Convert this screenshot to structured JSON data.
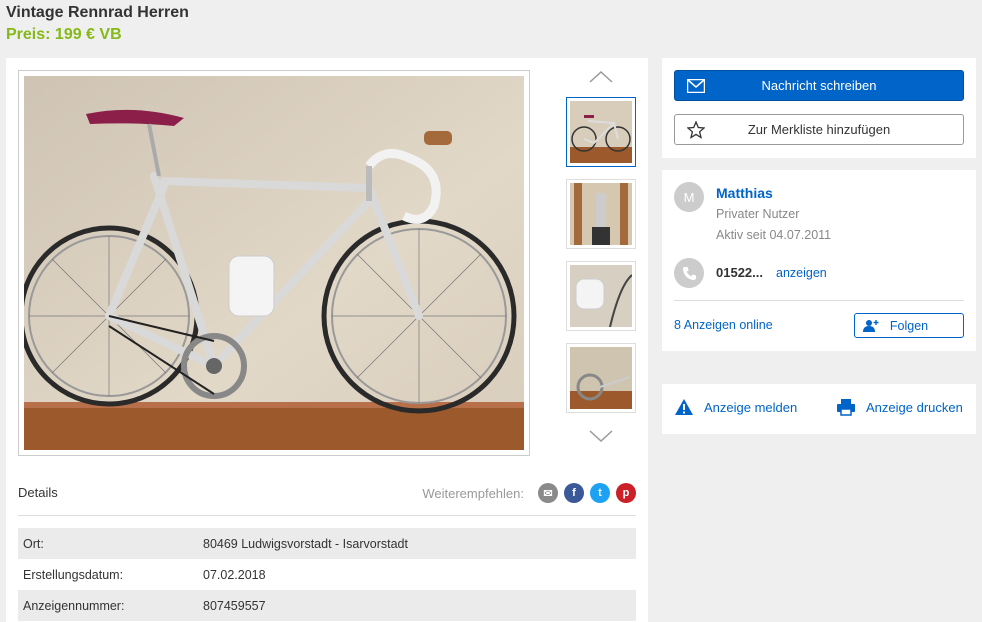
{
  "listing": {
    "title": "Vintage Rennrad Herren",
    "price": "Preis: 199 € VB"
  },
  "gallery": {
    "main_image_alt": "Vintage Rennrad",
    "thumbnail_count": 4
  },
  "details": {
    "label": "Details",
    "share_label": "Weiterempfehlen:",
    "share_buttons": [
      "email-icon",
      "facebook-icon",
      "twitter-icon",
      "pinterest-icon"
    ],
    "attributes": [
      {
        "key": "Ort:",
        "value": "80469 Ludwigsvorstadt - Isarvorstadt"
      },
      {
        "key": "Erstellungsdatum:",
        "value": "07.02.2018"
      },
      {
        "key": "Anzeigennummer:",
        "value": "807459557"
      }
    ]
  },
  "contact": {
    "message_button": "Nachricht schreiben",
    "watchlist_button": "Zur Merkliste hinzufügen"
  },
  "seller": {
    "avatar_letter": "M",
    "name": "Matthias",
    "type": "Privater Nutzer",
    "active_since": "Aktiv seit 04.07.2011",
    "phone": "01522...",
    "phone_show": "anzeigen",
    "ads_online": "8 Anzeigen online",
    "follow_button": "Folgen"
  },
  "actions": {
    "report": "Anzeige melden",
    "print": "Anzeige drucken"
  },
  "colors": {
    "accent": "#0064c8",
    "price": "#86b817",
    "background": "#efefef"
  }
}
